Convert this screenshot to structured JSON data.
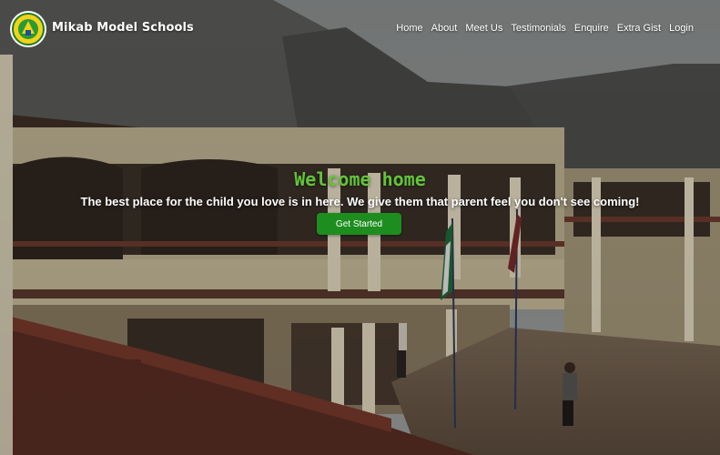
{
  "brand": {
    "name": "Mikab Model Schools",
    "logo_icon": "school-crest-icon"
  },
  "nav": {
    "items": [
      "Home",
      "About",
      "Meet Us",
      "Testimonials",
      "Enquire",
      "Extra Gist",
      "Login"
    ]
  },
  "hero": {
    "background": "school-building-photo",
    "heading": "Welcome home",
    "tagline": "The best place for the child you love is in here. We give them that parent feel you don't see coming!",
    "cta_label": "Get Started"
  },
  "colors": {
    "heading": "#63c33a",
    "cta_background": "#1d8d1f",
    "nav_text": "#ffffff"
  }
}
